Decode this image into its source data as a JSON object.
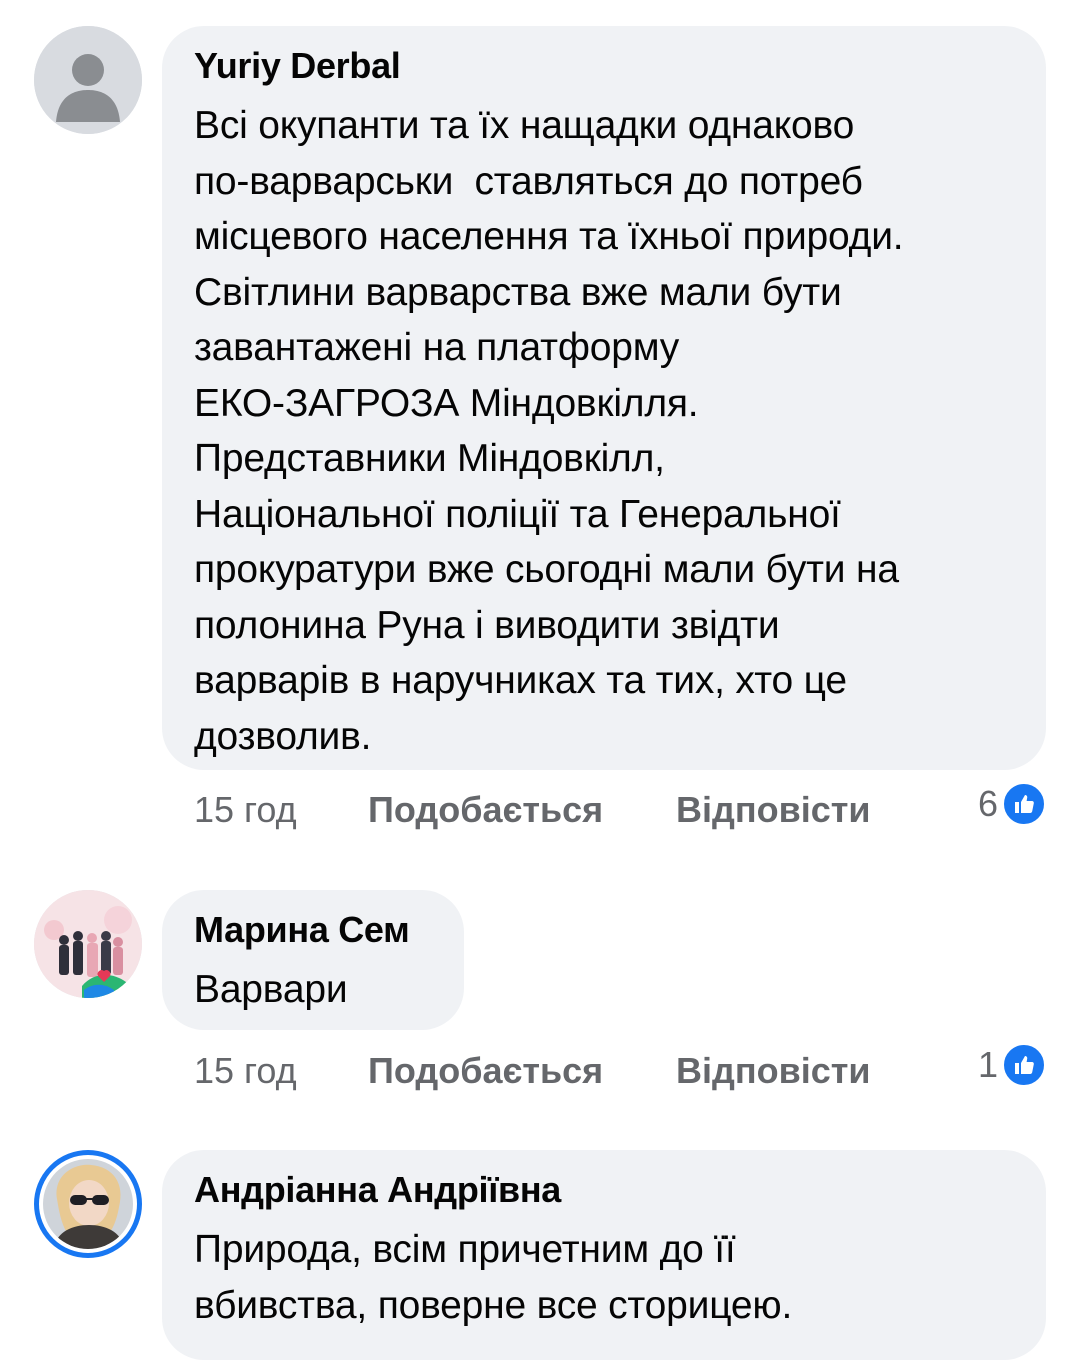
{
  "comments": [
    {
      "author": "Yuriy Derbal",
      "text": "Всі окупанти та їх нащадки однаково\nпо-варварськи  ставляться до потреб\nмісцевого населення та їхньої природи.\nСвітлини варварства вже мали бути\nзавантажені на платформу\nЕКО-ЗАГРОЗА Міндовкілля.\nПредставники Міндовкілл,\nНаціональної поліції та Генеральної\nпрокуратури вже сьогодні мали бути на\nполонина Руна і виводити звідти\nварварів в наручниках та тих, хто це\nдозволив.",
      "time": "15 год",
      "like_label": "Подобається",
      "reply_label": "Відповісти",
      "reaction_count": "6"
    },
    {
      "author": "Марина Сем",
      "text": "Варвари",
      "time": "15 год",
      "like_label": "Подобається",
      "reply_label": "Відповісти",
      "reaction_count": "1"
    },
    {
      "author": "Андріанна Андріївна",
      "text": "Природа, всім причетним до її\nвбивства, поверне все сторицею.",
      "time": "",
      "like_label": "",
      "reply_label": "",
      "reaction_count": ""
    }
  ],
  "icons": {
    "reaction": "like-thumbs-up-icon",
    "default_avatar": "user-silhouette-icon"
  },
  "colors": {
    "bubble": "#f0f2f5",
    "meta_text": "#65676b",
    "like_blue": "#1877f2",
    "story_ring": "#1877f2"
  }
}
